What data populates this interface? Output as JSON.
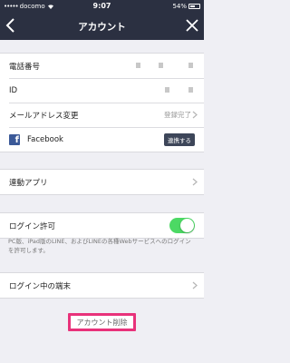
{
  "status_bar": {
    "signal": "•••••",
    "carrier": "docomo",
    "wifi_icon": "wifi-icon",
    "time": "9:07",
    "battery_percent": "54%"
  },
  "nav": {
    "title": "アカウント"
  },
  "account_group": {
    "phone_label": "電話番号",
    "id_label": "ID",
    "email_label": "メールアドレス変更",
    "email_status": "登録完了",
    "facebook_label": "Facebook",
    "facebook_button": "連携する"
  },
  "linked_apps": {
    "label": "連動アプリ"
  },
  "login_permission": {
    "label": "ログイン許可",
    "enabled": true,
    "note": "PC版、iPad版のLINE、およびLINEの各種Webサービスへのログインを許可します。"
  },
  "logged_in_devices": {
    "label": "ログイン中の端末"
  },
  "delete_account": {
    "label": "アカウント削除"
  },
  "colors": {
    "header": "#2b3041",
    "toggle_on": "#4cd964",
    "facebook": "#3b5998",
    "highlight": "#e8327a"
  }
}
